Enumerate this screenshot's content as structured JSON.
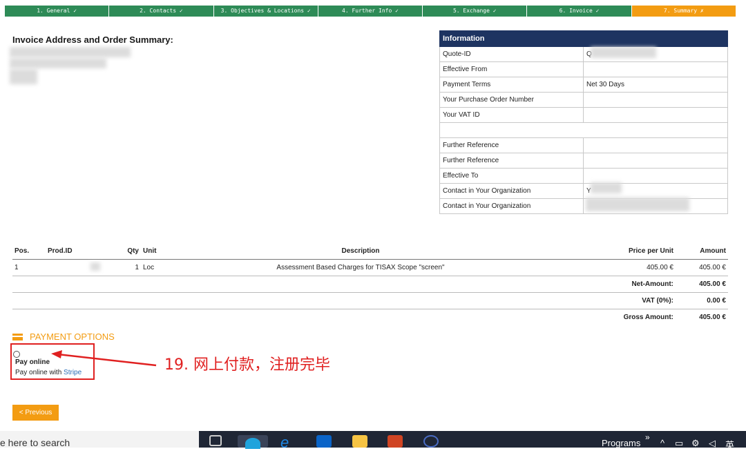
{
  "steps": [
    {
      "label": "1. General ✓"
    },
    {
      "label": "2. Contacts ✓"
    },
    {
      "label": "3. Objectives & Locations ✓"
    },
    {
      "label": "4. Further Info ✓"
    },
    {
      "label": "5. Exchange ✓"
    },
    {
      "label": "6. Invoice ✓"
    },
    {
      "label": "7. Summary ✗"
    }
  ],
  "invoice_title": "Invoice Address and Order Summary:",
  "information": {
    "header": "Information",
    "rows": [
      {
        "label": "Quote-ID",
        "value": "Q"
      },
      {
        "label": "Effective From",
        "value": ""
      },
      {
        "label": "Payment Terms",
        "value": "Net 30 Days"
      },
      {
        "label": "Your Purchase Order Number",
        "value": ""
      },
      {
        "label": "Your VAT ID",
        "value": ""
      },
      {
        "label": "",
        "value": ""
      },
      {
        "label": "Further Reference",
        "value": ""
      },
      {
        "label": "Further Reference",
        "value": ""
      },
      {
        "label": "Effective To",
        "value": ""
      },
      {
        "label": "Contact in Your Organization",
        "value": "Y"
      },
      {
        "label": "Contact in Your Organization",
        "value": ""
      }
    ]
  },
  "items": {
    "headers": {
      "pos": "Pos.",
      "prod": "Prod.ID",
      "qty": "Qty",
      "unit": "Unit",
      "desc": "Description",
      "price": "Price per Unit",
      "amount": "Amount"
    },
    "rows": [
      {
        "pos": "1",
        "prod": "",
        "qty": "1",
        "unit": "Loc",
        "desc": "Assessment Based Charges for TISAX Scope \"screen\"",
        "price": "405.00 €",
        "amount": "405.00 €"
      }
    ],
    "totals": [
      {
        "label": "Net-Amount:",
        "value": "405.00 €"
      },
      {
        "label": "VAT (0%):",
        "value": "0.00 €"
      },
      {
        "label": "Gross Amount:",
        "value": "405.00 €"
      }
    ]
  },
  "payment": {
    "title": "PAYMENT OPTIONS",
    "option_label": "Pay online",
    "option_desc": "Pay online with",
    "option_link": "Stripe"
  },
  "annotation": "19. 网上付款，注册完毕",
  "previous_button": "< Previous",
  "taskbar": {
    "search_placeholder": "e here to search",
    "programs": "Programs",
    "chevron": "»",
    "ime": "英"
  },
  "colors": {
    "step_done": "#2e8b57",
    "step_active": "#f39c12",
    "info_header": "#1e3461",
    "accent": "#f39c12",
    "annotation": "#e02020"
  }
}
